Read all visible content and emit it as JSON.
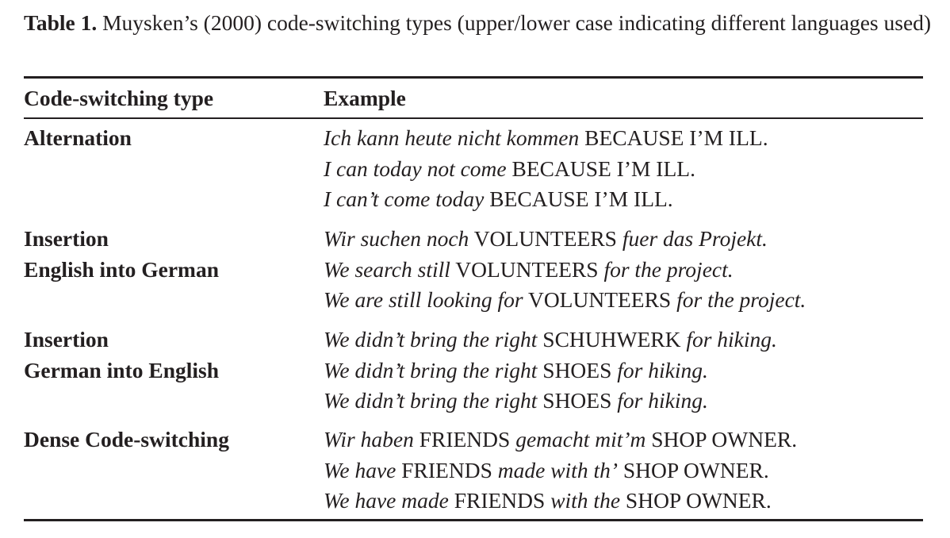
{
  "caption": {
    "label": "Table 1.",
    "text": " Muysken’s (2000) code-switching types (upper/lower case indicating different languages used)"
  },
  "headers": {
    "type": "Code-switching type",
    "example": "Example"
  },
  "rows": [
    {
      "type_lines": [
        "Alternation"
      ],
      "examples": [
        [
          {
            "t": "Ich kann heute nicht kommen",
            "i": true
          },
          {
            "t": " BECAUSE I’M ILL.",
            "i": false
          }
        ],
        [
          {
            "t": "I can today not come",
            "i": true
          },
          {
            "t": " BECAUSE I’M ILL.",
            "i": false
          }
        ],
        [
          {
            "t": "I can’t come today",
            "i": true
          },
          {
            "t": " BECAUSE I’M ILL.",
            "i": false
          }
        ]
      ]
    },
    {
      "type_lines": [
        "Insertion",
        "English into German"
      ],
      "examples": [
        [
          {
            "t": "Wir suchen noch",
            "i": true
          },
          {
            "t": " VOLUNTEERS ",
            "i": false
          },
          {
            "t": "fuer das Projekt.",
            "i": true
          }
        ],
        [
          {
            "t": "We search still",
            "i": true
          },
          {
            "t": " VOLUNTEERS ",
            "i": false
          },
          {
            "t": "for the project.",
            "i": true
          }
        ],
        [
          {
            "t": "We are still looking for",
            "i": true
          },
          {
            "t": " VOLUNTEERS ",
            "i": false
          },
          {
            "t": "for the project.",
            "i": true
          }
        ]
      ]
    },
    {
      "type_lines": [
        "Insertion",
        "German into English"
      ],
      "examples": [
        [
          {
            "t": "We didn’t bring the right",
            "i": true
          },
          {
            "t": " SCHUHWERK ",
            "i": false
          },
          {
            "t": "for hiking.",
            "i": true
          }
        ],
        [
          {
            "t": "We didn’t bring the right",
            "i": true
          },
          {
            "t": " SHOES ",
            "i": false
          },
          {
            "t": "for hiking.",
            "i": true
          }
        ],
        [
          {
            "t": "We didn’t bring the right",
            "i": true
          },
          {
            "t": " SHOES ",
            "i": false
          },
          {
            "t": "for hiking.",
            "i": true
          }
        ]
      ]
    },
    {
      "type_lines": [
        "Dense Code-switching"
      ],
      "examples": [
        [
          {
            "t": "Wir haben",
            "i": true
          },
          {
            "t": " FRIENDS ",
            "i": false
          },
          {
            "t": "gemacht mit’m",
            "i": true
          },
          {
            "t": " SHOP OWNER.",
            "i": false
          }
        ],
        [
          {
            "t": "We have",
            "i": true
          },
          {
            "t": " FRIENDS ",
            "i": false
          },
          {
            "t": "made with th’",
            "i": true
          },
          {
            "t": " SHOP OWNER.",
            "i": false
          }
        ],
        [
          {
            "t": "We have made",
            "i": true
          },
          {
            "t": " FRIENDS ",
            "i": false
          },
          {
            "t": "with the",
            "i": true
          },
          {
            "t": " SHOP OWNER.",
            "i": false
          }
        ]
      ]
    }
  ]
}
